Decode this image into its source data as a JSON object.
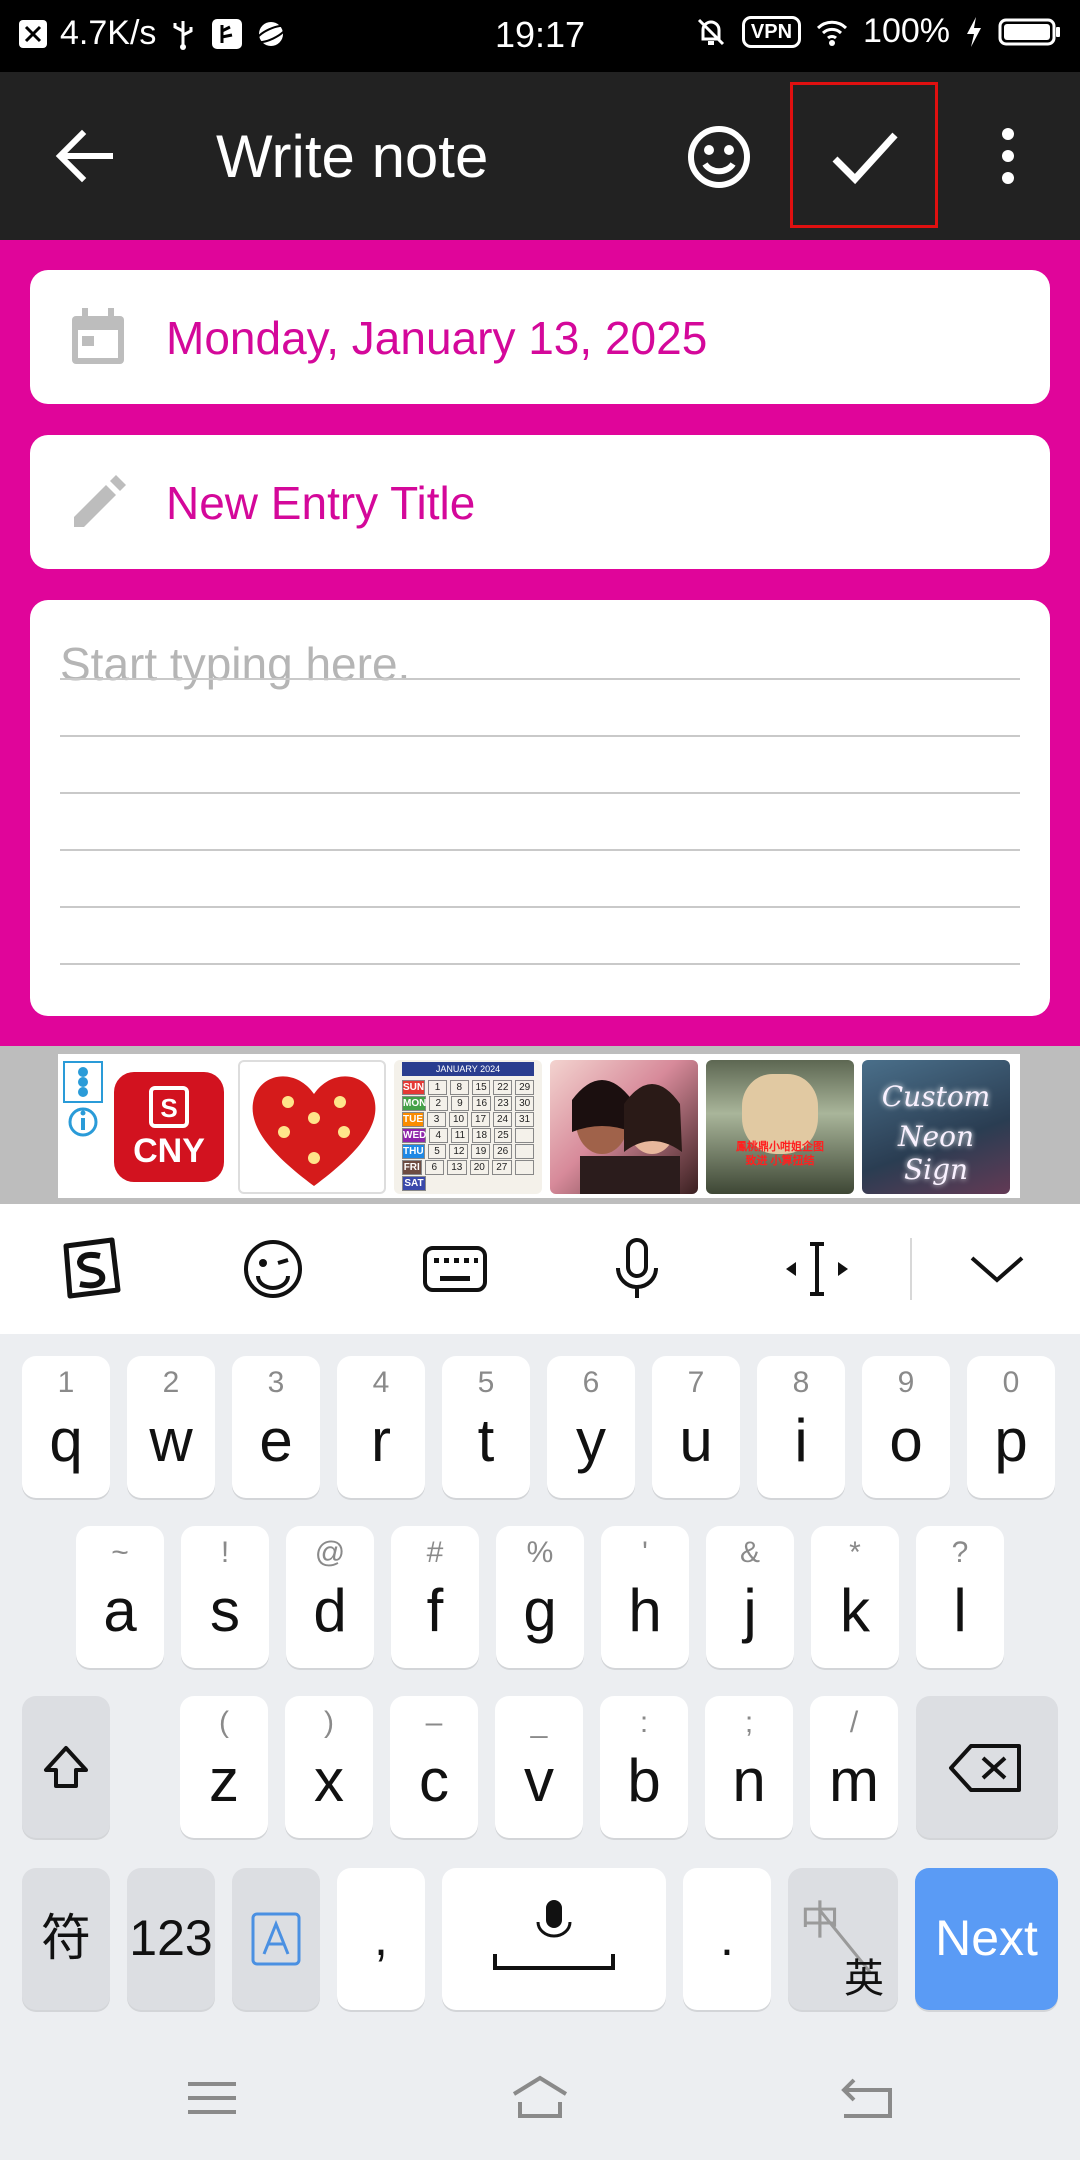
{
  "status_bar": {
    "speed": "4.7K/s",
    "time": "19:17",
    "vpn": "VPN",
    "battery": "100%"
  },
  "app_bar": {
    "title": "Write note",
    "icons": [
      "back-arrow-icon",
      "emoji-icon",
      "checkmark-icon",
      "more-vert-icon"
    ]
  },
  "note": {
    "date": "Monday, January 13, 2025",
    "title_placeholder": "New Entry Title",
    "body_placeholder": "Start typing here."
  },
  "ads": {
    "cny_label": "CNY",
    "cny_bag_letter": "S",
    "calendar_header": "JANUARY 2024",
    "doll_caption": "鳳桃鼎小咁姐企图致进 小算扭结",
    "neon_line1": "Custom",
    "neon_line2": "Neon Sign",
    "calendar": {
      "days": [
        "SUN",
        "MON",
        "TUE",
        "WED",
        "THU",
        "FRI",
        "SAT"
      ],
      "day_colors": [
        "#e53935",
        "#43a047",
        "#fb8c00",
        "#8e24aa",
        "#1e88e5",
        "#6d4c41",
        "#3949ab"
      ],
      "rows": [
        [
          "",
          "1",
          "8",
          "15",
          "22",
          "29"
        ],
        [
          "",
          "2",
          "9",
          "16",
          "23",
          "30"
        ],
        [
          "",
          "3",
          "10",
          "17",
          "24",
          "31"
        ],
        [
          "",
          "4",
          "11",
          "18",
          "25",
          ""
        ],
        [
          "",
          "5",
          "12",
          "19",
          "26",
          ""
        ],
        [
          "",
          "6",
          "13",
          "20",
          "27",
          ""
        ]
      ]
    }
  },
  "keyboard": {
    "row1": [
      {
        "hint": "1",
        "key": "q"
      },
      {
        "hint": "2",
        "key": "w"
      },
      {
        "hint": "3",
        "key": "e"
      },
      {
        "hint": "4",
        "key": "r"
      },
      {
        "hint": "5",
        "key": "t"
      },
      {
        "hint": "6",
        "key": "y"
      },
      {
        "hint": "7",
        "key": "u"
      },
      {
        "hint": "8",
        "key": "i"
      },
      {
        "hint": "9",
        "key": "o"
      },
      {
        "hint": "0",
        "key": "p"
      }
    ],
    "row2": [
      {
        "hint": "~",
        "key": "a"
      },
      {
        "hint": "!",
        "key": "s"
      },
      {
        "hint": "@",
        "key": "d"
      },
      {
        "hint": "#",
        "key": "f"
      },
      {
        "hint": "%",
        "key": "g"
      },
      {
        "hint": "'",
        "key": "h"
      },
      {
        "hint": "&",
        "key": "j"
      },
      {
        "hint": "*",
        "key": "k"
      },
      {
        "hint": "?",
        "key": "l"
      }
    ],
    "row3": [
      {
        "hint": "(",
        "key": "z"
      },
      {
        "hint": ")",
        "key": "x"
      },
      {
        "hint": "–",
        "key": "c"
      },
      {
        "hint": "_",
        "key": "v"
      },
      {
        "hint": ":",
        "key": "b"
      },
      {
        "hint": ";",
        "key": "n"
      },
      {
        "hint": "/",
        "key": "m"
      }
    ],
    "symbols_label": "符",
    "numbers_label": "123",
    "comma_label": ",",
    "period_label": ".",
    "lang_top": "中",
    "lang_bottom": "英",
    "next_label": "Next"
  },
  "colors": {
    "accent_pink": "#e0059a",
    "text_pink": "#d4089a",
    "next_blue": "#5a9bf5",
    "highlight_red": "#e01010"
  }
}
